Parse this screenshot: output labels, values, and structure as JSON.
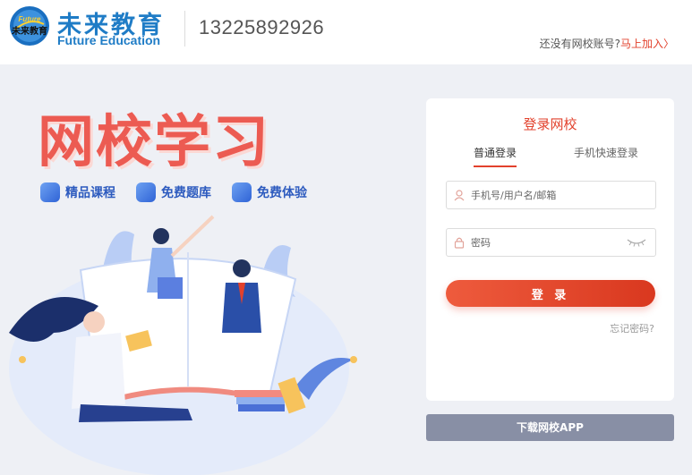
{
  "header": {
    "logo_cn": "未来教育",
    "logo_en": "Future Education",
    "logo_badge_text": [
      "Future",
      "未来教育"
    ],
    "phone": "13225892926",
    "register_prompt": "还没有网校账号?",
    "register_link": "马上加入",
    "register_arrow": "〉"
  },
  "hero": {
    "title": "网校学习",
    "features": [
      {
        "label": "精品课程",
        "icon": "video-icon"
      },
      {
        "label": "免费题库",
        "icon": "document-icon"
      },
      {
        "label": "免费体验",
        "icon": "cloud-icon"
      }
    ]
  },
  "login": {
    "title": "登录网校",
    "tabs": [
      {
        "label": "普通登录",
        "active": true
      },
      {
        "label": "手机快速登录",
        "active": false
      }
    ],
    "username_placeholder": "手机号/用户名/邮箱",
    "password_placeholder": "密码",
    "submit_label": "登 录",
    "forgot_label": "忘记密码?"
  },
  "download_app_label": "下载网校APP",
  "colors": {
    "brand_blue": "#1f7cc6",
    "accent_red": "#e2412c",
    "hero_red": "#ec5b52",
    "feature_blue": "#2d5bbf",
    "page_bg": "#eef0f5",
    "app_button": "#888fa5"
  }
}
